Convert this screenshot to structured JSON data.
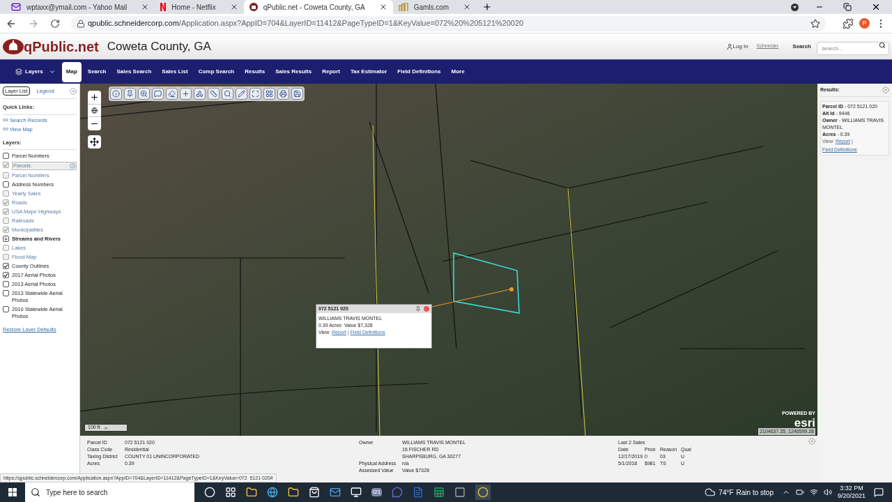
{
  "browser": {
    "tabs": [
      {
        "title": "wptaxx@ymail.com - Yahoo Mail",
        "selected": false,
        "kind": "mail"
      },
      {
        "title": "Home - Netflix",
        "selected": false,
        "kind": "netflix"
      },
      {
        "title": "qPublic.net - Coweta County, GA",
        "selected": true,
        "kind": "site"
      },
      {
        "title": "Gamls.com",
        "selected": false,
        "kind": "gamls"
      }
    ],
    "url_host": "qpublic.schneidercorp.com",
    "url_path": "/Application.aspx?AppID=704&LayerID=11412&PageTypeID=1&KeyValue=072%20%205121%20020",
    "profile_initial": "P",
    "status_url": "https://qpublic.schneidercorp.com/Application.aspx?AppID=704&LayerID=11412&PageTypeID=1&KeyValue=072  5121 020#"
  },
  "site": {
    "logo": "qPublic.net",
    "county": "Coweta County, GA",
    "login": "Log In",
    "vendor": "Schneider",
    "search_label": "Search",
    "search_placeholder": "search..."
  },
  "nav": [
    {
      "label": "Layers",
      "selected": false,
      "kind": "dropdown"
    },
    {
      "label": "Map",
      "selected": true,
      "kind": "link"
    },
    {
      "label": "Search",
      "selected": false,
      "kind": "link"
    },
    {
      "label": "Sales Search",
      "selected": false,
      "kind": "link"
    },
    {
      "label": "Sales List",
      "selected": false,
      "kind": "link"
    },
    {
      "label": "Comp Search",
      "selected": false,
      "kind": "link"
    },
    {
      "label": "Results",
      "selected": false,
      "kind": "link"
    },
    {
      "label": "Sales Results",
      "selected": false,
      "kind": "link"
    },
    {
      "label": "Report",
      "selected": false,
      "kind": "link"
    },
    {
      "label": "Tax Estimator",
      "selected": false,
      "kind": "link"
    },
    {
      "label": "Field Definitions",
      "selected": false,
      "kind": "link"
    },
    {
      "label": "More",
      "selected": false,
      "kind": "link"
    }
  ],
  "left_panel": {
    "tabs": [
      {
        "label": "Layer List",
        "selected": true
      },
      {
        "label": "Legend",
        "selected": false
      }
    ],
    "quick_links_title": "Quick Links:",
    "quick_links": [
      "Search Records",
      "View Map"
    ],
    "layers_title": "Layers:",
    "layers": [
      {
        "label": "Parcel Numbers",
        "kind": "checkbox",
        "checked": false,
        "disabled": false,
        "selected": false
      },
      {
        "label": "Parcels",
        "kind": "checkbox",
        "checked": true,
        "disabled": true,
        "selected": true
      },
      {
        "label": "Parcel Numbers",
        "kind": "checkbox",
        "checked": false,
        "disabled": true,
        "selected": false
      },
      {
        "label": "Address Numbers",
        "kind": "checkbox",
        "checked": false,
        "disabled": false,
        "selected": false
      },
      {
        "label": "Yearly Sales",
        "kind": "checkbox",
        "checked": false,
        "disabled": true,
        "selected": false
      },
      {
        "label": "Roads",
        "kind": "checkbox",
        "checked": true,
        "disabled": true,
        "selected": false
      },
      {
        "label": "USA Major Highways",
        "kind": "checkbox",
        "checked": true,
        "disabled": true,
        "selected": false
      },
      {
        "label": "Railroads",
        "kind": "checkbox",
        "checked": false,
        "disabled": true,
        "selected": false
      },
      {
        "label": "Municipalities",
        "kind": "checkbox",
        "checked": true,
        "disabled": true,
        "selected": false
      },
      {
        "label": "Streams and Rivers",
        "kind": "group",
        "expanded": false,
        "selected": false
      },
      {
        "label": "Lakes",
        "kind": "checkbox",
        "checked": false,
        "disabled": true,
        "selected": false
      },
      {
        "label": "Flood Map",
        "kind": "checkbox",
        "checked": false,
        "disabled": true,
        "selected": false
      },
      {
        "label": "County Outlines",
        "kind": "checkbox",
        "checked": true,
        "disabled": false,
        "selected": false
      },
      {
        "label": "2017 Aerial Photos",
        "kind": "checkbox",
        "checked": true,
        "disabled": false,
        "selected": false
      },
      {
        "label": "2013 Aerial Photos",
        "kind": "checkbox",
        "checked": false,
        "disabled": false,
        "selected": false
      },
      {
        "label": "2013 Statewide Aerial Photos",
        "kind": "checkbox",
        "checked": false,
        "disabled": false,
        "selected": false
      },
      {
        "label": "2010 Statewide Aerial Photos",
        "kind": "checkbox",
        "checked": false,
        "disabled": false,
        "selected": false
      }
    ],
    "restore": "Restore Layer Defaults"
  },
  "map": {
    "popup": {
      "title": "072 5121 020",
      "owner": "WILLIAMS TRAVIS MONTEL",
      "summary": "0.39 Acres  Value $7,328",
      "view_label": "View:",
      "links": [
        "Report",
        "Field Definitions"
      ],
      "separator": "|"
    },
    "scale": "100 ft",
    "esri_powered": "POWERED BY",
    "esri": "esri",
    "coordinates": "2104637.35, 1246599.28"
  },
  "results": {
    "title": "Results:",
    "rows": [
      "**Parcel ID** - 072 5121 020",
      "**Alt Id** - 9446",
      "**Owner** - WILLIAMS TRAVIS MONTEL",
      "**Acres** - 0.39"
    ],
    "view_label": "View:",
    "links": [
      "Report",
      "Field Definitions"
    ],
    "separator": "|"
  },
  "info": {
    "left": [
      {
        "label": "Parcel ID",
        "value": "072 5121 020"
      },
      {
        "label": "Class Code",
        "value": "Residential"
      },
      {
        "label": "Taxing District",
        "value": "COUNTY 01 UNINCORPORATED"
      },
      {
        "label": "Acres",
        "value": "0.39"
      }
    ],
    "owner_label": "Owner",
    "owner_lines": [
      "WILLIAMS TRAVIS MONTEL",
      "16 FISCHER RD",
      "SHARPSBURG, GA 30277"
    ],
    "middle": [
      {
        "label": "Physical Address",
        "value": "n/a"
      },
      {
        "label": "Assessed Value",
        "value": "Value $7328"
      }
    ],
    "sales_title": "Last 2 Sales",
    "sales_columns": [
      "Date",
      "Price",
      "Reason",
      "Qual"
    ],
    "sales_rows": [
      [
        "12/17/2019",
        "0",
        "03",
        "U"
      ],
      [
        "5/1/2018",
        "$981",
        "TS",
        "U"
      ]
    ]
  },
  "taskbar": {
    "search_placeholder": "Type here to search",
    "app_label": "t21",
    "temperature": "74°F",
    "weather": "Rain to stop",
    "time": "3:32 PM",
    "date": "9/20/2021"
  }
}
